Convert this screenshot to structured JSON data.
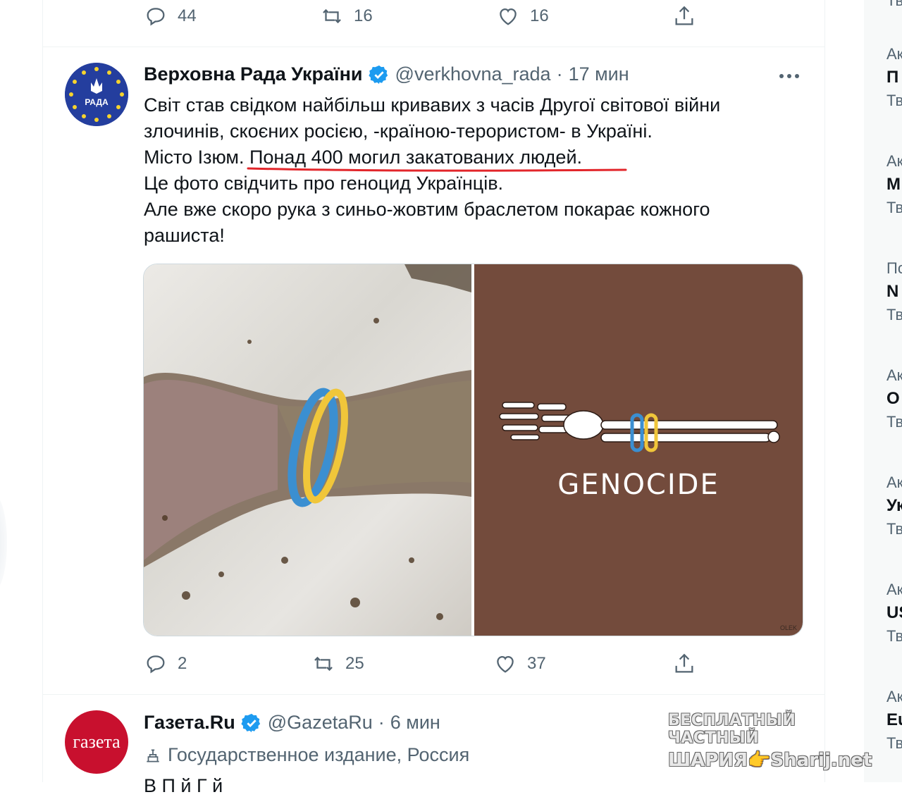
{
  "prev_tweet": {
    "reply_count": "44",
    "retweet_count": "16",
    "like_count": "16"
  },
  "tweet": {
    "display_name": "Верховна Рада України",
    "handle": "@verkhovna_rada",
    "separator": "·",
    "time": "17 мин",
    "avatar_text": "РАДА",
    "lines": [
      "Світ став свідком найбільш кривавих з часів Другої світової війни",
      "злочинів, скоєних росією, -країною-терористом- в Україні.",
      "Місто Ізюм.",
      "Понад 400 могил закатованих людей.",
      "Це фото свідчить про геноцид Українців.",
      "Але вже скоро рука з синьо-жовтим браслетом покарає кожного",
      "рашиста!"
    ],
    "image_caption": "GENOCIDE",
    "image_signature": "OLEK",
    "reply_count": "2",
    "retweet_count": "25",
    "like_count": "37",
    "colors": {
      "underline": "#e2262b",
      "verified": "#1d9bf0",
      "bracelet_blue": "#3b8fd1",
      "bracelet_yellow": "#f0c63a"
    }
  },
  "next_tweet": {
    "display_name": "Газета.Ru",
    "handle": "@GazetaRu",
    "separator": "·",
    "time": "6 мин",
    "avatar_text": "газета",
    "label": "Государственное издание, Россия",
    "text_partial": "В П                                                       й               Г    й"
  },
  "sidebar_trends": [
    {
      "cat": "Тв",
      "title": "",
      "count": ""
    },
    {
      "cat": "Ак",
      "title": "П",
      "count": "Тв"
    },
    {
      "cat": "Ак",
      "title": "М",
      "count": "Тв"
    },
    {
      "cat": "По",
      "title": "N",
      "count": "Тв"
    },
    {
      "cat": "Ак",
      "title": "О",
      "count": "Тв"
    },
    {
      "cat": "Ак",
      "title": "Ук",
      "count": "Тв"
    },
    {
      "cat": "Ак",
      "title": "US",
      "count": "Тв"
    },
    {
      "cat": "Ак",
      "title": "Eu",
      "count": "Тв"
    }
  ],
  "watermark": {
    "line1": "БЕСПЛАТНЫЙ ЧАСТНЫЙ",
    "line2": "ШАРИЯ👉Sharij.net"
  }
}
